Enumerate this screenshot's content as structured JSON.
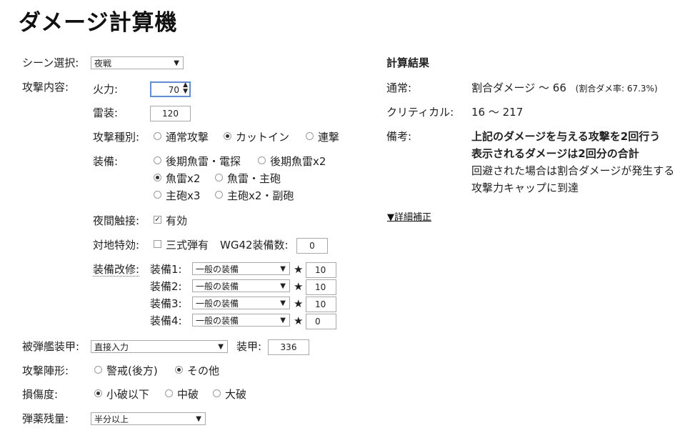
{
  "title": "ダメージ計算機",
  "scene": {
    "label": "シーン選択:",
    "value": "夜戦"
  },
  "attack": {
    "label": "攻撃内容:",
    "firepower_label": "火力:",
    "firepower_value": "70",
    "torpedo_label": "雷装:",
    "torpedo_value": "120",
    "type_label": "攻撃種別:",
    "types": [
      "通常攻撃",
      "カットイン",
      "連撃"
    ],
    "equip_label": "装備:",
    "equip_options": [
      "後期魚雷・電探",
      "後期魚雷x2",
      "魚雷x2",
      "魚雷・主砲",
      "主砲x3",
      "主砲x2・副砲"
    ],
    "night_contact_label": "夜間触接:",
    "night_contact_option": "有効",
    "anti_ground_label": "対地特効:",
    "anti_ground_option": "三式弾有",
    "wg42_label": "WG42装備数:",
    "wg42_value": "0",
    "improve_label": "装備改修:",
    "improvements": [
      {
        "label": "装備1:",
        "select": "一般の装備",
        "stars": "10"
      },
      {
        "label": "装備2:",
        "select": "一般の装備",
        "stars": "10"
      },
      {
        "label": "装備3:",
        "select": "一般の装備",
        "stars": "10"
      },
      {
        "label": "装備4:",
        "select": "一般の装備",
        "stars": "0"
      }
    ],
    "star_symbol": "★"
  },
  "target": {
    "armor_label": "被弾艦装甲:",
    "armor_mode": "直接入力",
    "armor_value_label": "装甲:",
    "armor_value": "336"
  },
  "formation": {
    "label": "攻撃陣形:",
    "options": [
      "警戒(後方)",
      "その他"
    ]
  },
  "damage_state": {
    "label": "損傷度:",
    "options": [
      "小破以下",
      "中破",
      "大破"
    ]
  },
  "ammo": {
    "label": "弾薬残量:",
    "value": "半分以上"
  },
  "result": {
    "heading": "計算結果",
    "normal_label": "通常:",
    "normal_value": "割合ダメージ ～ 66",
    "normal_note": "(割合ダメ率: 67.3%)",
    "critical_label": "クリティカル:",
    "critical_value": "16 ～ 217",
    "remarks_label": "備考:",
    "remarks": [
      "上記のダメージを与える攻撃を2回行う",
      "表示されるダメージは2回分の合計",
      "回避された場合は割合ダメージが発生する",
      "攻撃力キャップに到達"
    ],
    "detail_link": "▼詳細補正"
  }
}
